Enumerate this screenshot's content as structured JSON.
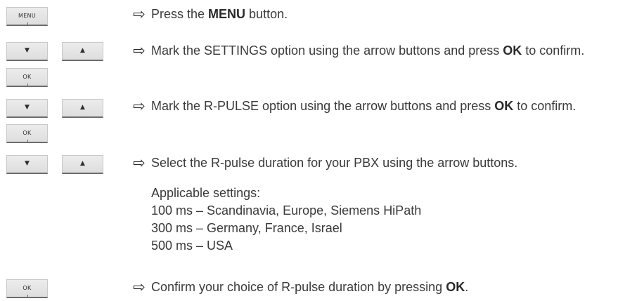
{
  "keys": {
    "menu": "MENU",
    "ok": "OK",
    "down": "▼",
    "up": "▲"
  },
  "icons": {
    "step_arrow": "outline-right-arrow"
  },
  "steps": [
    {
      "pre": "Press the ",
      "bold": "MENU",
      "post": " button."
    },
    {
      "pre": "Mark the SETTINGS option using the arrow buttons and press ",
      "bold": "OK",
      "post": " to confirm."
    },
    {
      "pre": "Mark the R-PULSE option using the arrow buttons and press ",
      "bold": "OK",
      "post": " to confirm."
    },
    {
      "pre": "Select the R-pulse duration for your PBX using the arrow buttons."
    },
    {
      "pre": "Confirm your choice of R-pulse duration by pressing ",
      "bold": "OK",
      "post": "."
    }
  ],
  "settings": {
    "heading": "Applicable settings:",
    "lines": [
      "100 ms – Scandinavia, Europe, Siemens HiPath",
      "300 ms – Germany, France, Israel",
      "500 ms – USA"
    ]
  }
}
